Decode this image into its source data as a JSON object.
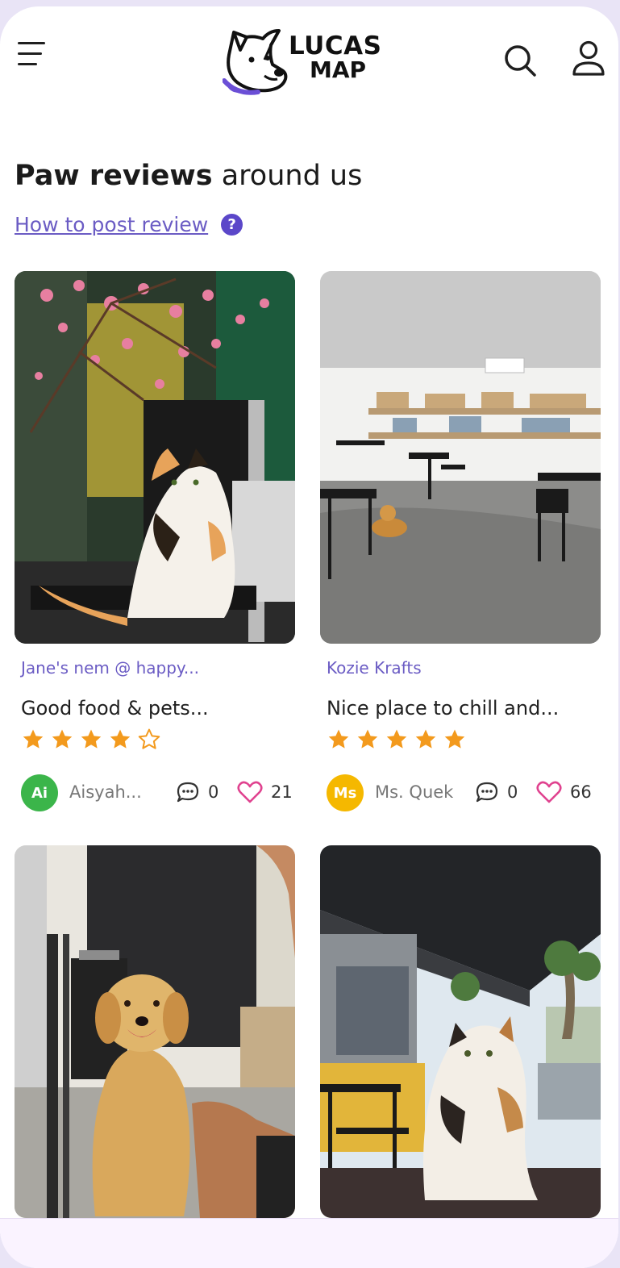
{
  "app": {
    "logo_line1": "LUCAS",
    "logo_line2": "MAP"
  },
  "header": {
    "menu_icon": "hamburger-menu-icon",
    "search_icon": "search-icon",
    "profile_icon": "user-profile-icon"
  },
  "page": {
    "title_bold": "Paw reviews",
    "title_light": "around us",
    "howto_link": "How to post review",
    "help_glyph": "?"
  },
  "colors": {
    "accent": "#6b5cc4",
    "star": "#f39a1d",
    "heart": "#e0428f",
    "avatar_green": "#3bb54a",
    "avatar_yellow": "#f5b800"
  },
  "reviews": [
    {
      "place": "Jane's nem @ happy...",
      "title": "Good food & pets...",
      "rating": 4,
      "author_initials": "Ai",
      "author": "Aisyah...",
      "comments": "0",
      "likes": "21",
      "photo": "calico cat sitting on a black chair under pink blossoms"
    },
    {
      "place": "Kozie Krafts",
      "title": "Nice place to chill and...",
      "rating": 5,
      "author_initials": "Ms",
      "author": "Ms. Quek",
      "comments": "0",
      "likes": "66",
      "photo": "cafe interior with tables, shelves and a golden retriever lying on the floor"
    },
    {
      "photo": "smiling golden retriever sitting indoors"
    },
    {
      "photo": "calico cat on a seat under an awning on a street"
    }
  ]
}
